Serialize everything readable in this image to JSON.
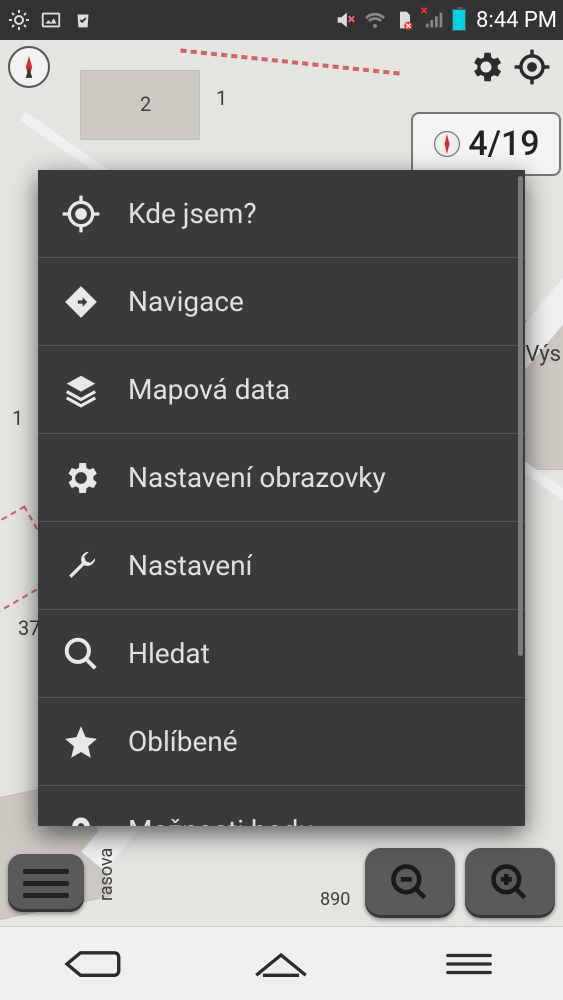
{
  "statusbar": {
    "time": "8:44 PM"
  },
  "toolbar": {},
  "date_badge": {
    "value": "4/19"
  },
  "map": {
    "labels": {
      "n2": "2",
      "n1": "1",
      "n37": "37",
      "vys": "Výs",
      "n1b": "1",
      "n890": "890",
      "street": "rasova"
    }
  },
  "menu": {
    "items": [
      {
        "label": "Kde jsem?"
      },
      {
        "label": "Navigace"
      },
      {
        "label": "Mapová data"
      },
      {
        "label": "Nastavení obrazovky"
      },
      {
        "label": "Nastavení"
      },
      {
        "label": "Hledat"
      },
      {
        "label": "Oblíbené"
      },
      {
        "label": "Možnosti bodu…"
      }
    ]
  }
}
